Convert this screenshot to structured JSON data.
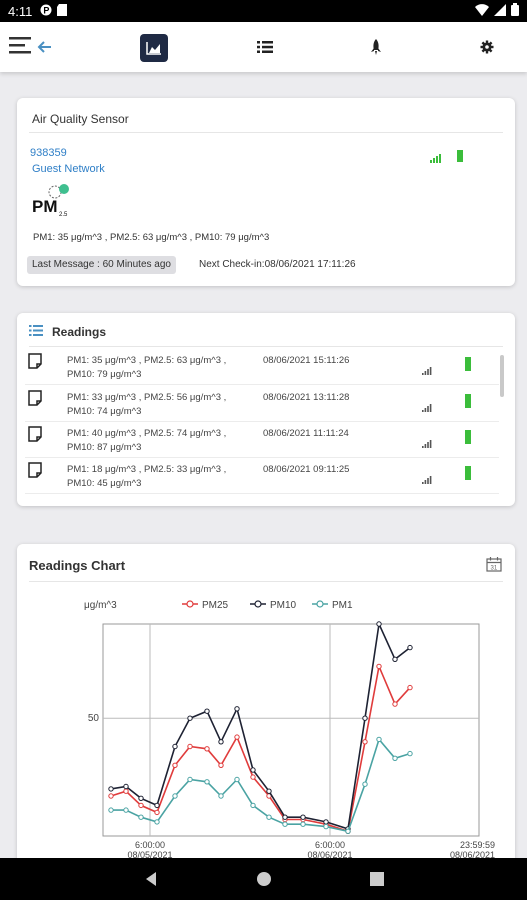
{
  "statusbar": {
    "time": "4:11"
  },
  "toolbar": {
    "menu_icon": "hamburger-icon",
    "back_icon": "arrow-left-icon",
    "chart_icon": "area-chart-icon",
    "list_icon": "list-icon",
    "rocket_icon": "rocket-icon",
    "settings_icon": "gear-icon",
    "active_color": "#1f2a44",
    "accent_color": "#4a90c2"
  },
  "sensor": {
    "title": "Air Quality Sensor",
    "id": "938359",
    "network": "Guest Network",
    "logo_text": "PM",
    "logo_sub": "2.5",
    "values": "PM1: 35 μg/m^3 , PM2.5: 63 μg/m^3 , PM10: 79 μg/m^3",
    "last_message": "Last Message : 60 Minutes ago",
    "next_checkin": "Next Check-in:08/06/2021 17:11:26",
    "signal_color": "#3bbd3b"
  },
  "readings": {
    "title": "Readings",
    "rows": [
      {
        "line1": "PM1: 35 μg/m^3 , PM2.5: 63 μg/m^3 ,",
        "line2": "PM10: 79 μg/m^3",
        "date": "08/06/2021 15:11:26"
      },
      {
        "line1": "PM1: 33 μg/m^3 , PM2.5: 56 μg/m^3 ,",
        "line2": "PM10: 74 μg/m^3",
        "date": "08/06/2021 13:11:28"
      },
      {
        "line1": "PM1: 40 μg/m^3 , PM2.5: 74 μg/m^3 ,",
        "line2": "PM10: 87 μg/m^3",
        "date": "08/06/2021 11:11:24"
      },
      {
        "line1": "PM1: 18 μg/m^3 , PM2.5: 33 μg/m^3 ,",
        "line2": "PM10: 45 μg/m^3",
        "date": "08/06/2021 09:11:25"
      }
    ]
  },
  "chart": {
    "title": "Readings Chart",
    "calendar_icon": "calendar-icon"
  },
  "chart_data": {
    "type": "line",
    "ylabel": "μg/m^3",
    "ytick": "50",
    "ylim": [
      0,
      90
    ],
    "x_ticks": [
      {
        "time": "6:00:00",
        "date": "08/05/2021"
      },
      {
        "time": "6:00:00",
        "date": "08/06/2021"
      },
      {
        "time": "23:59:59",
        "date": "08/06/2021"
      }
    ],
    "legend_position": "top",
    "series": [
      {
        "name": "PM25",
        "color": "#e03c3c",
        "values": [
          17,
          19,
          13,
          10,
          30,
          38,
          37,
          30,
          42,
          25,
          17,
          7,
          7,
          5,
          2,
          40,
          72,
          56,
          63
        ]
      },
      {
        "name": "PM10",
        "color": "#1e2233",
        "values": [
          20,
          21,
          16,
          13,
          38,
          50,
          53,
          40,
          54,
          28,
          19,
          8,
          8,
          6,
          3,
          50,
          90,
          75,
          80
        ]
      },
      {
        "name": "PM1",
        "color": "#4aa3a3",
        "values": [
          11,
          11,
          8,
          6,
          17,
          24,
          23,
          17,
          24,
          13,
          8,
          5,
          5,
          4,
          2,
          22,
          41,
          33,
          35
        ]
      }
    ]
  }
}
